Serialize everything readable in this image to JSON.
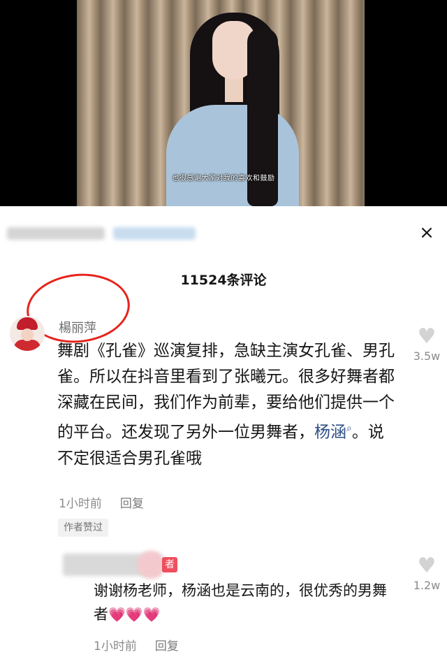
{
  "video": {
    "subtitle": "也很感谢大家对我的喜欢和鼓励"
  },
  "header": {
    "close_icon": "×",
    "comment_count": "11524条评论"
  },
  "comment": {
    "username": "楊丽萍",
    "text_before": "舞剧《孔雀》巡演复排，急缺主演女孔雀、男孔雀。所以在抖音里看到了张曦元。很多好舞者都深藏在民间，我们作为前辈，要给他们提供一个的平台。还发现了另外一位男舞者，",
    "mention": "杨涵",
    "text_after": "。说不定很适合男孔雀哦",
    "time": "1小时前",
    "reply_label": "回复",
    "like_count": "3.5w",
    "author_liked": "作者赞过"
  },
  "reply": {
    "tag": "者",
    "text": "谢谢杨老师，杨涵也是云南的，很优秀的男舞者",
    "emojis": "💗💗💗",
    "time": "1小时前",
    "reply_label": "回复",
    "like_count": "1.2w"
  },
  "icons": {
    "heart_icon": "♥",
    "search_icon": "⌕"
  },
  "colors": {
    "accent_red": "#e6231b",
    "mention_blue": "#2d4e86",
    "tag_pink": "#ee4f5d"
  }
}
